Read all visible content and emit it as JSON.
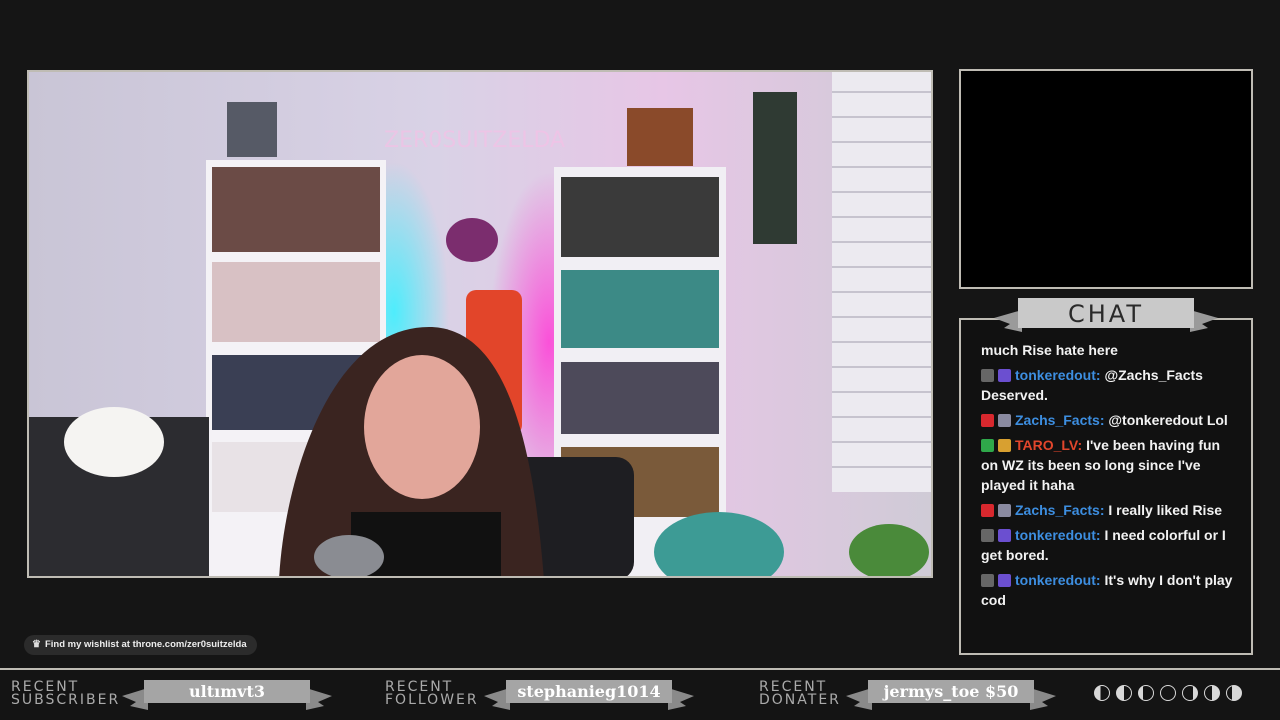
{
  "chat": {
    "title": "CHAT",
    "messages": [
      {
        "user": "",
        "text": "much Rise hate here",
        "color": ""
      },
      {
        "user": "tonkeredout",
        "sep": ":",
        "text": "@Zachs_Facts Deserved.",
        "color": "#3d8ee0"
      },
      {
        "user": "Zachs_Facts",
        "sep": ":",
        "text": "@tonkeredout Lol",
        "color": "#3d8ee0"
      },
      {
        "user": "TARO_LV",
        "sep": ":",
        "text": "I've been having fun on WZ its been so long since I've played it haha",
        "color": "#e2462c"
      },
      {
        "user": "Zachs_Facts",
        "sep": ":",
        "text": "I really liked Rise",
        "color": "#3d8ee0"
      },
      {
        "user": "tonkeredout",
        "sep": ":",
        "text": "I need colorful or I get bored.",
        "color": "#3d8ee0"
      },
      {
        "user": "tonkeredout",
        "sep": ":",
        "text": "It's why I don't play cod",
        "color": "#3d8ee0"
      }
    ]
  },
  "wishlist": {
    "text": "Find my wishlist at throne.com/zer0suitzelda",
    "icon": "crown-icon"
  },
  "bottombar": {
    "subscriber": {
      "label_top": "RECENT",
      "label_bottom": "SUBSCRIBER",
      "name": "ultımvt3"
    },
    "follower": {
      "label_top": "RECENT",
      "label_bottom": "FOLLOWER",
      "name": "stephanieg1014"
    },
    "donater": {
      "label_top": "RECENT",
      "label_bottom": "DONATER",
      "name": "jermys_toe $50"
    }
  },
  "colors": {
    "frame": "#bfbcb4",
    "background": "#151515",
    "ribbon": "#9a9a9a",
    "chat_name_blue": "#3d8ee0",
    "chat_name_red": "#e2462c"
  },
  "webcam": {
    "neon_sign": "ZER0SUITZELDA"
  }
}
